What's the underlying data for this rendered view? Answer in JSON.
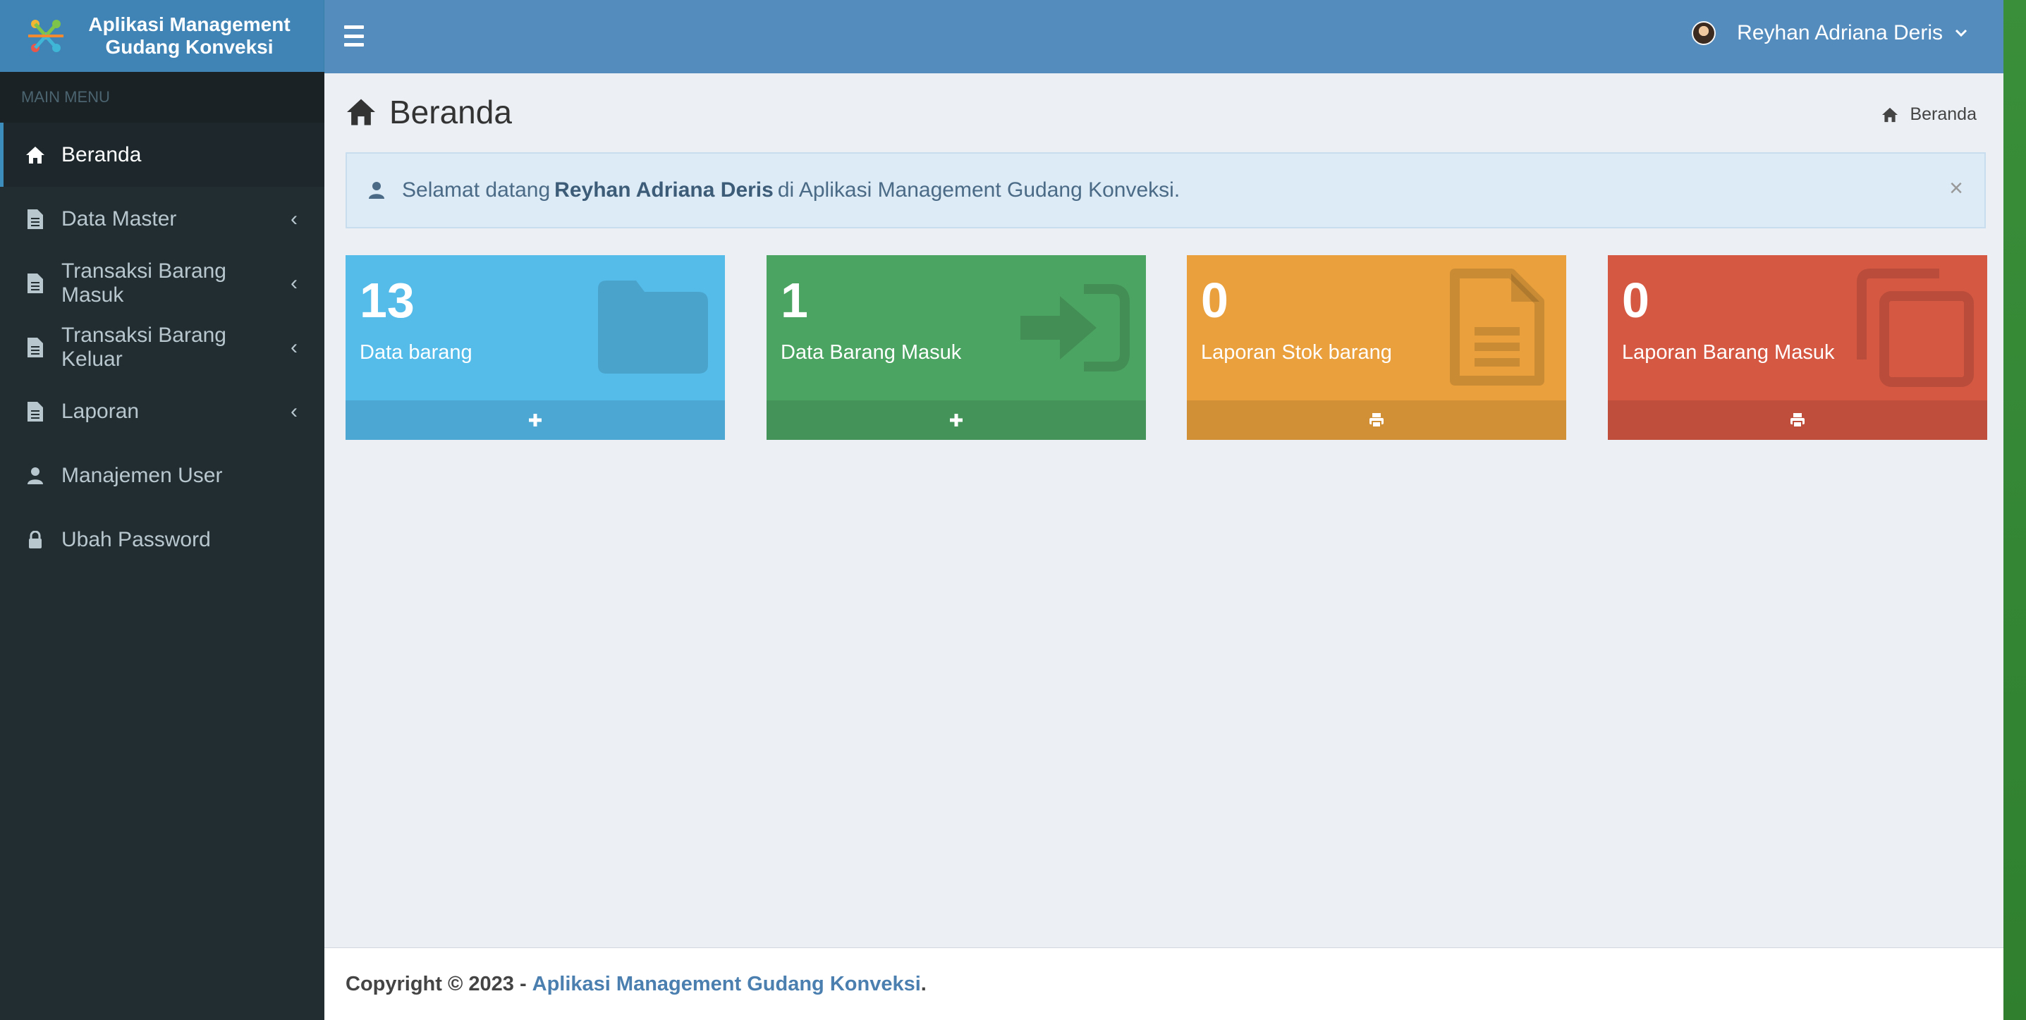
{
  "brand": {
    "line1": "Aplikasi Management",
    "line2": "Gudang Konveksi"
  },
  "sidebar": {
    "header": "MAIN MENU",
    "items": [
      {
        "label": "Beranda",
        "icon": "home-icon",
        "active": true,
        "has_arrow": false
      },
      {
        "label": "Data Master",
        "icon": "file-icon",
        "active": false,
        "has_arrow": true
      },
      {
        "label": "Transaksi Barang Masuk",
        "icon": "file-icon",
        "active": false,
        "has_arrow": true
      },
      {
        "label": "Transaksi Barang Keluar",
        "icon": "file-icon",
        "active": false,
        "has_arrow": true
      },
      {
        "label": "Laporan",
        "icon": "file-icon",
        "active": false,
        "has_arrow": true
      },
      {
        "label": "Manajemen User",
        "icon": "user-icon",
        "active": false,
        "has_arrow": false
      },
      {
        "label": "Ubah Password",
        "icon": "lock-icon",
        "active": false,
        "has_arrow": false
      }
    ]
  },
  "navbar": {
    "user_name": "Reyhan Adriana Deris"
  },
  "page": {
    "title": "Beranda",
    "breadcrumb": "Beranda"
  },
  "alert": {
    "prefix": "Selamat datang",
    "name": "Reyhan Adriana Deris",
    "suffix": "di Aplikasi Management Gudang Konveksi.",
    "close": "×"
  },
  "boxes": [
    {
      "value": "13",
      "label": "Data barang",
      "icon": "folder-icon",
      "footer_icon": "plus-icon",
      "color": "#55bcea"
    },
    {
      "value": "1",
      "label": "Data Barang Masuk",
      "icon": "sign-in-icon",
      "footer_icon": "plus-icon",
      "color": "#4ca462"
    },
    {
      "value": "0",
      "label": "Laporan Stok barang",
      "icon": "file-text-icon",
      "footer_icon": "print-icon",
      "color": "#e9a03d"
    },
    {
      "value": "0",
      "label": "Laporan Barang Masuk",
      "icon": "copy-icon",
      "footer_icon": "print-icon",
      "color": "#d55843"
    }
  ],
  "footer": {
    "copyright": "Copyright © 2023 -",
    "link": "Aplikasi Management Gudang Konveksi",
    "end": "."
  },
  "colors": {
    "navbar": "#548cbd",
    "sidebar": "#222d32",
    "accent": "#3c8dbc"
  }
}
